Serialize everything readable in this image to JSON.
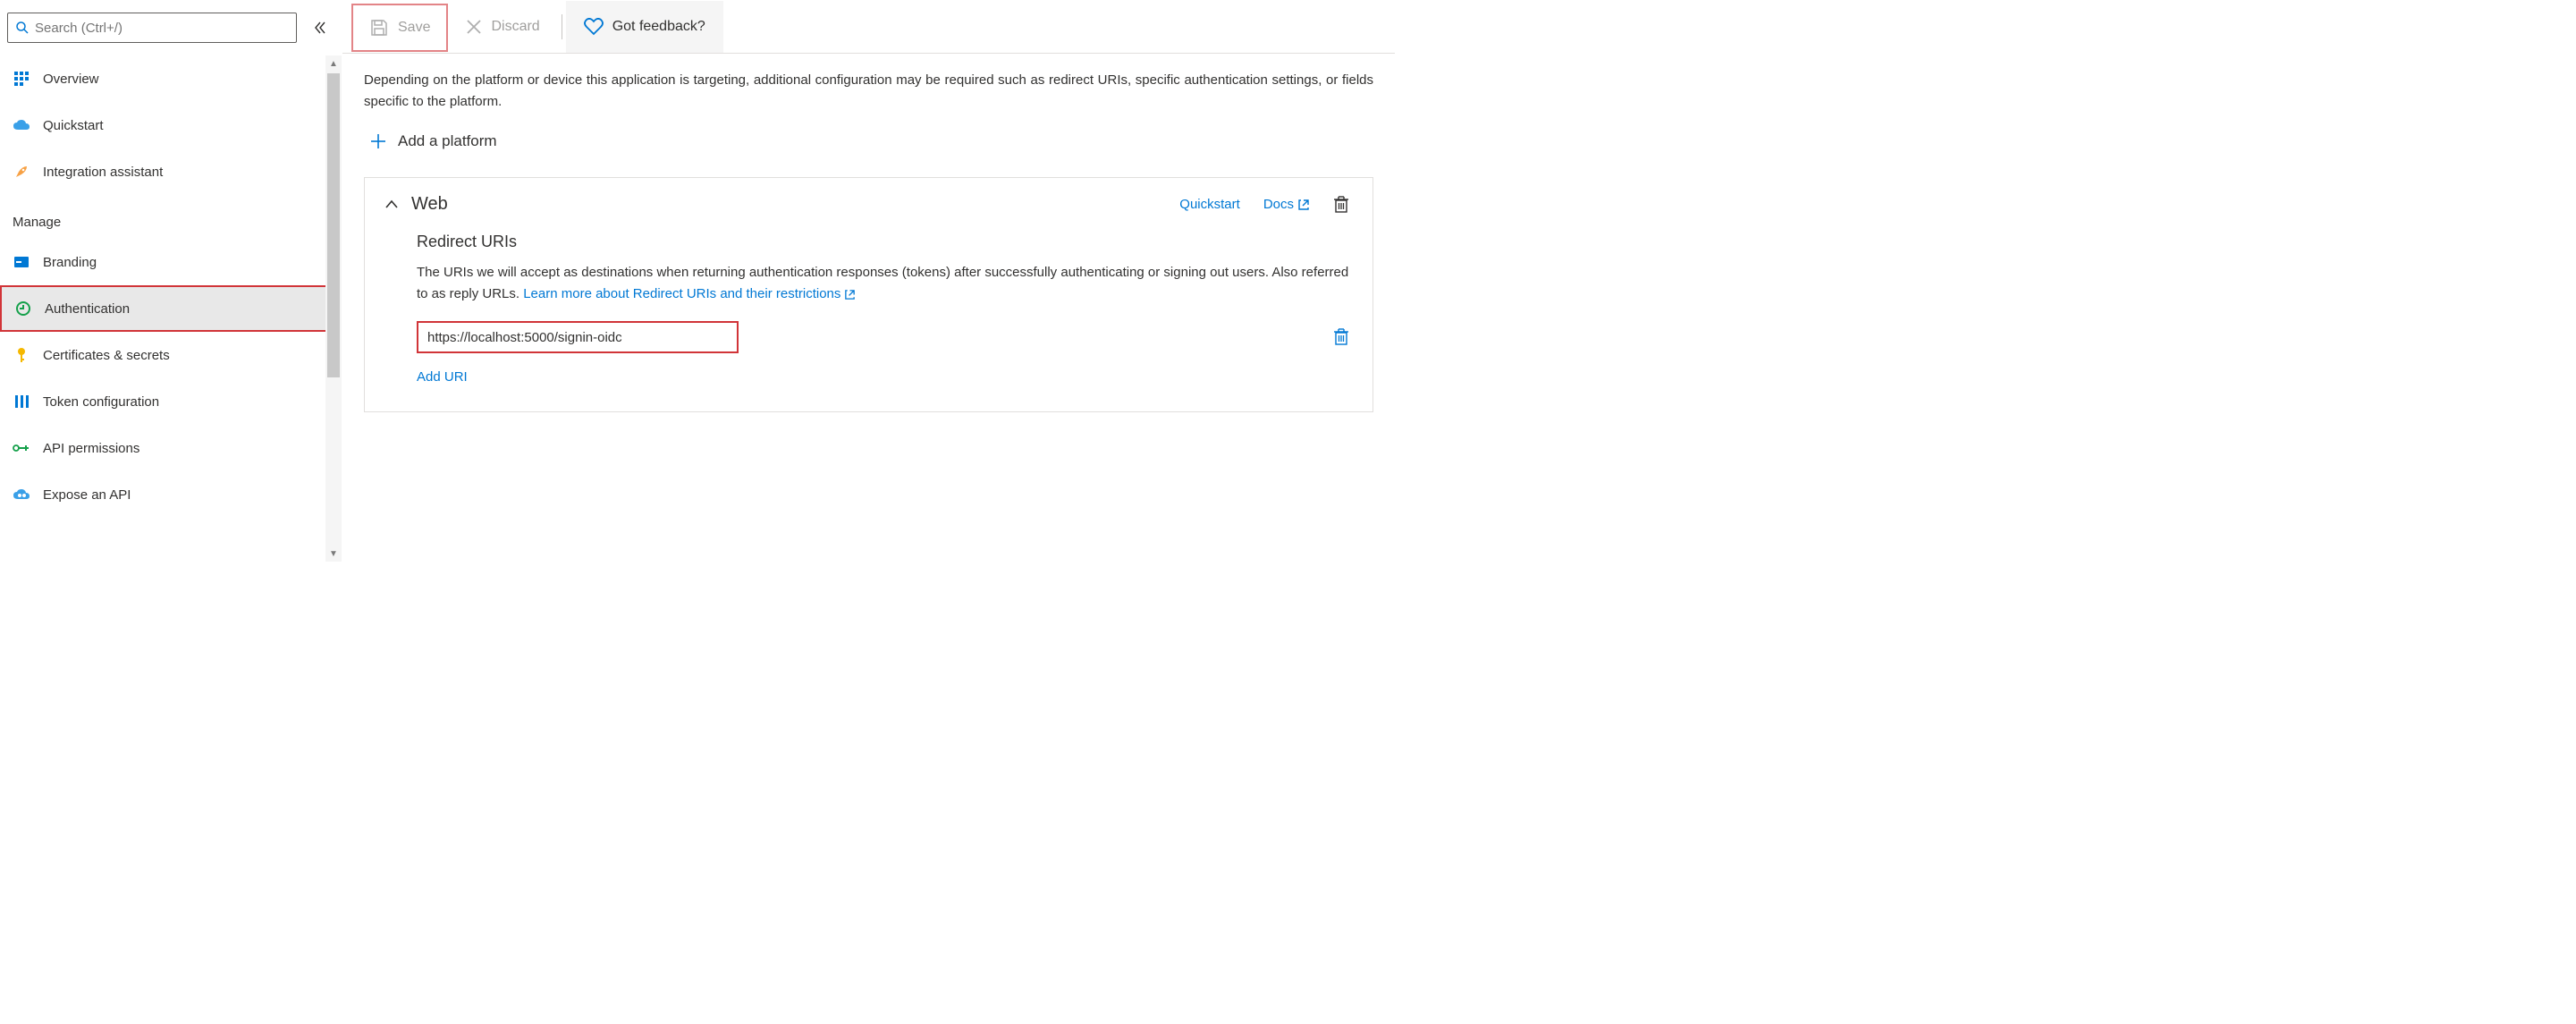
{
  "search": {
    "placeholder": "Search (Ctrl+/)"
  },
  "sidebar": {
    "items": [
      {
        "label": "Overview"
      },
      {
        "label": "Quickstart"
      },
      {
        "label": "Integration assistant"
      }
    ],
    "section": "Manage",
    "manage": [
      {
        "label": "Branding"
      },
      {
        "label": "Authentication"
      },
      {
        "label": "Certificates & secrets"
      },
      {
        "label": "Token configuration"
      },
      {
        "label": "API permissions"
      },
      {
        "label": "Expose an API"
      }
    ]
  },
  "toolbar": {
    "save": "Save",
    "discard": "Discard",
    "feedback": "Got feedback?"
  },
  "content": {
    "intro": "Depending on the platform or device this application is targeting, additional configuration may be required such as redirect URIs, specific authentication settings, or fields specific to the platform.",
    "add_platform": "Add a platform",
    "card": {
      "title": "Web",
      "quickstart": "Quickstart",
      "docs": "Docs",
      "subhead": "Redirect URIs",
      "desc1": "The URIs we will accept as destinations when returning authentication responses (tokens) after successfully authenticating or signing out users. Also referred to as reply URLs. ",
      "learn": "Learn more about Redirect URIs and their restrictions",
      "uri": "https://localhost:5000/signin-oidc",
      "add_uri": "Add URI"
    }
  }
}
